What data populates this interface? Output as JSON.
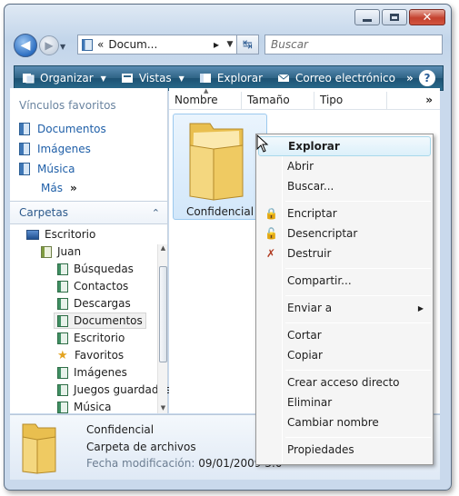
{
  "window": {
    "caption_buttons": [
      "minimize",
      "maximize",
      "close"
    ]
  },
  "nav": {
    "address_prefix": "«",
    "address_text": "Docum...",
    "address_chevron": "▸",
    "search_placeholder": "Buscar"
  },
  "toolbar": {
    "items": [
      {
        "label": "Organizar",
        "has_dropdown": true,
        "icon": "organize-icon"
      },
      {
        "label": "Vistas",
        "has_dropdown": true,
        "icon": "views-icon"
      },
      {
        "label": "Explorar",
        "has_dropdown": false,
        "icon": "explore-icon"
      },
      {
        "label": "Correo electrónico",
        "has_dropdown": false,
        "icon": "email-icon"
      }
    ],
    "more": "»",
    "help": "?"
  },
  "sidebar": {
    "favorites_header": "Vínculos favoritos",
    "favorites": [
      "Documentos",
      "Imágenes",
      "Música"
    ],
    "more_label": "Más",
    "more_glyph": "»",
    "folders_header": "Carpetas",
    "tree": [
      {
        "label": "Escritorio",
        "icon": "desktop-icon"
      },
      {
        "label": "Juan",
        "icon": "user-folder-icon"
      },
      {
        "label": "Búsquedas",
        "icon": "folder-icon"
      },
      {
        "label": "Contactos",
        "icon": "folder-icon"
      },
      {
        "label": "Descargas",
        "icon": "folder-icon"
      },
      {
        "label": "Documentos",
        "icon": "folder-icon",
        "selected": true
      },
      {
        "label": "Escritorio",
        "icon": "folder-icon"
      },
      {
        "label": "Favoritos",
        "icon": "star-icon"
      },
      {
        "label": "Imágenes",
        "icon": "folder-icon"
      },
      {
        "label": "Juegos guardados",
        "icon": "folder-icon"
      },
      {
        "label": "Música",
        "icon": "folder-icon"
      }
    ]
  },
  "columns": [
    "Nombre",
    "Tamaño",
    "Tipo"
  ],
  "columns_more": "»",
  "files": [
    {
      "label": "Confidencial",
      "icon": "folder-icon"
    }
  ],
  "context_menu": {
    "items": [
      {
        "label": "Explorar",
        "highlighted": true
      },
      {
        "label": "Abrir"
      },
      {
        "label": "Buscar..."
      },
      {
        "label": "Encriptar",
        "icon": "encrypt-lock-icon"
      },
      {
        "label": "Desencriptar",
        "icon": "decrypt-lock-icon"
      },
      {
        "label": "Destruir",
        "icon": "destroy-icon"
      },
      {
        "label": "Compartir..."
      },
      {
        "label": "Enviar a",
        "submenu": true
      },
      {
        "label": "Cortar"
      },
      {
        "label": "Copiar"
      },
      {
        "label": "Crear acceso directo"
      },
      {
        "label": "Eliminar"
      },
      {
        "label": "Cambiar nombre"
      },
      {
        "label": "Propiedades"
      }
    ]
  },
  "details": {
    "name": "Confidencial",
    "type": "Carpeta de archivos",
    "date_label": "Fecha modificación:",
    "date_value": "09/01/2009 3:0"
  },
  "colors": {
    "toolbar": "#2a6589",
    "link": "#1f5fa8",
    "menu_highlight": "#dcf0fa",
    "folder": "#f2cf6a"
  }
}
